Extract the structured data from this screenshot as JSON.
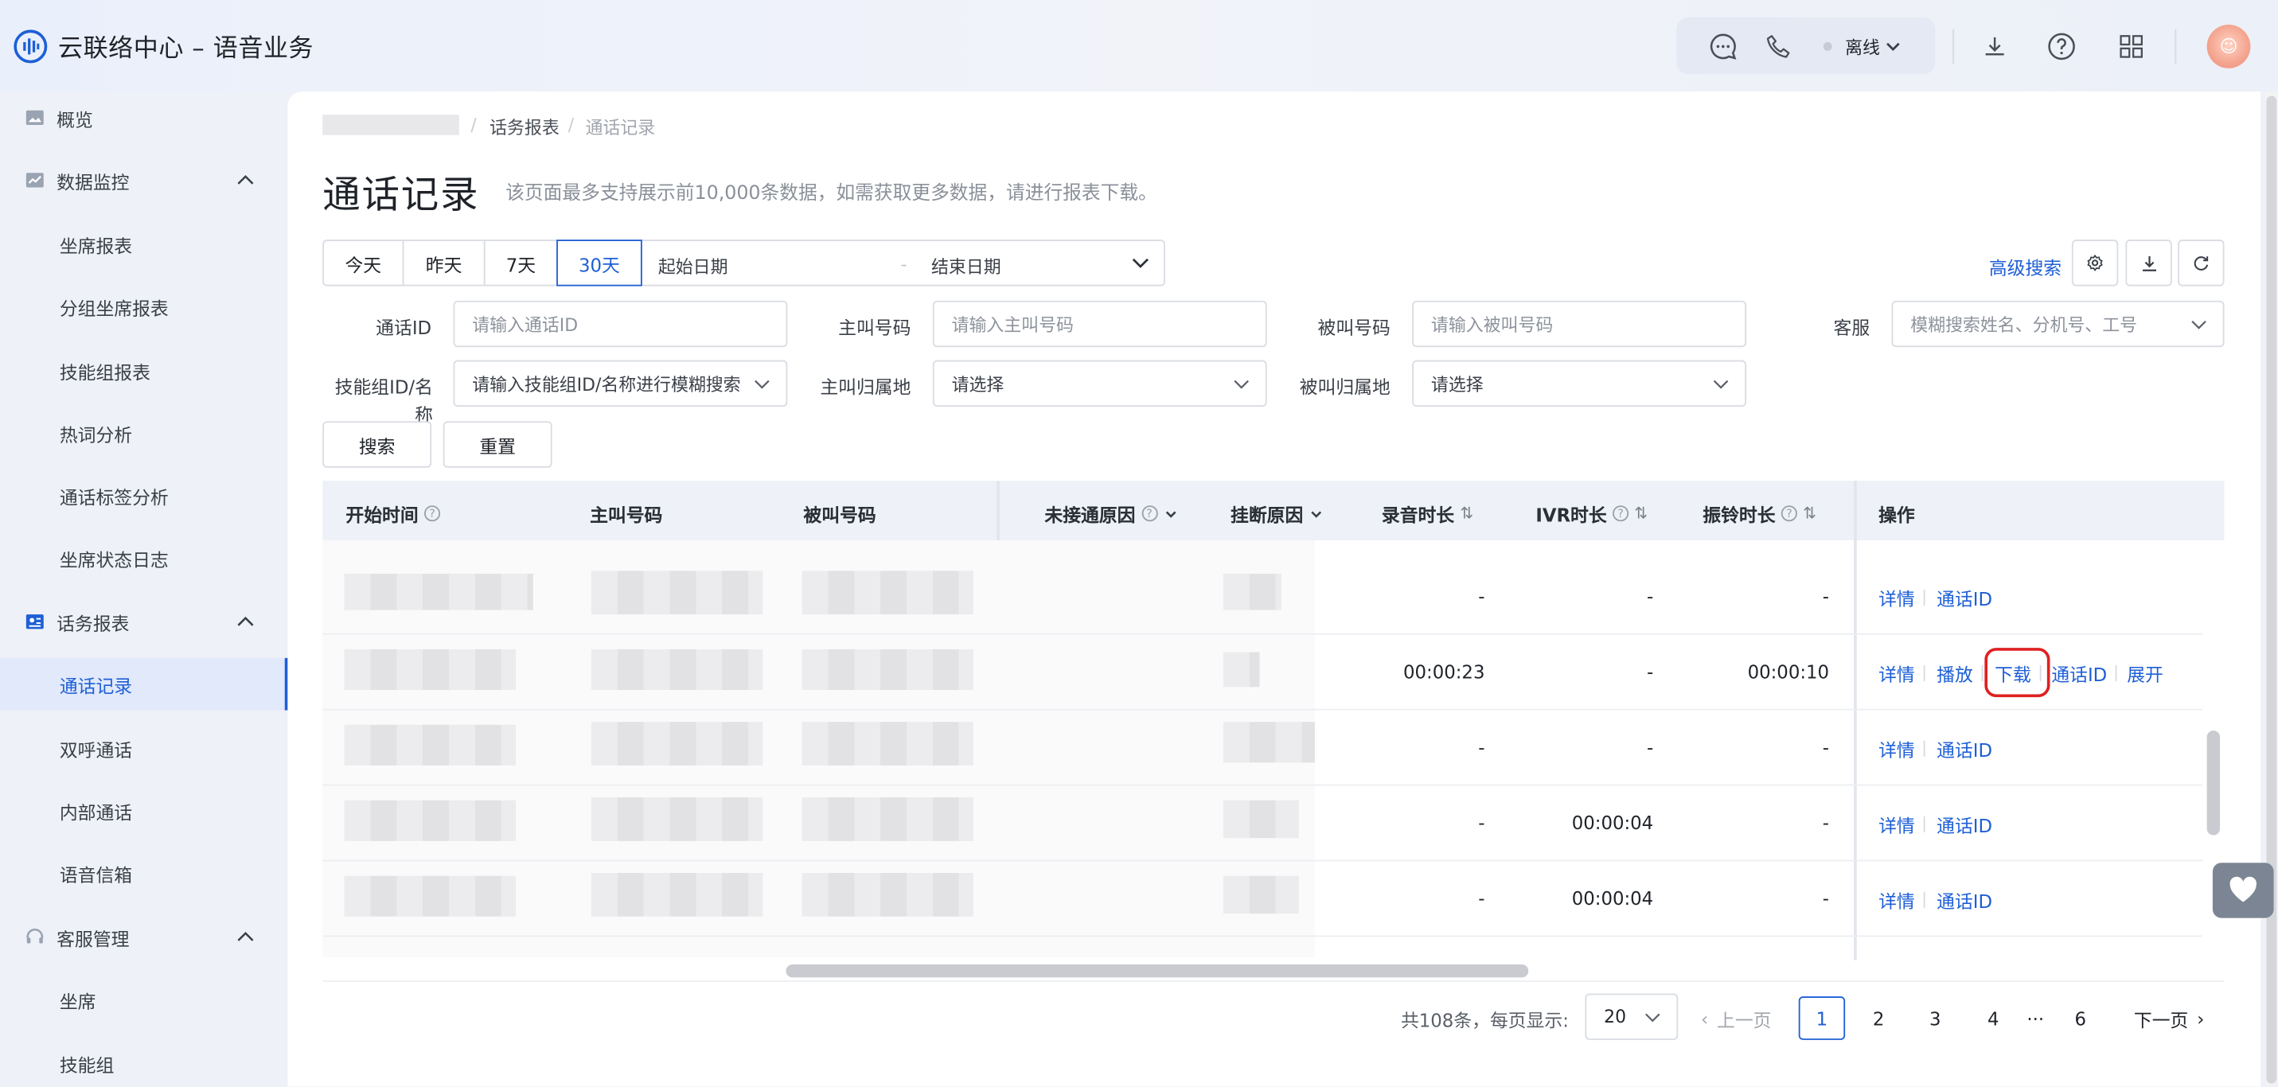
{
  "app": {
    "title": "云联络中心 – 语音业务"
  },
  "topbar": {
    "status": "离线"
  },
  "sidebar": {
    "items": [
      {
        "label": "概览",
        "icon": "image-icon"
      },
      {
        "label": "数据监控",
        "icon": "chart-icon"
      },
      {
        "label": "坐席报表"
      },
      {
        "label": "分组坐席报表"
      },
      {
        "label": "技能组报表"
      },
      {
        "label": "热词分析"
      },
      {
        "label": "通话标签分析"
      },
      {
        "label": "坐席状态日志"
      },
      {
        "label": "话务报表",
        "icon": "report-icon"
      },
      {
        "label": "通话记录"
      },
      {
        "label": "双呼通话"
      },
      {
        "label": "内部通话"
      },
      {
        "label": "语音信箱"
      },
      {
        "label": "客服管理",
        "icon": "headset-icon"
      },
      {
        "label": "坐席"
      },
      {
        "label": "技能组"
      }
    ]
  },
  "breadcrumb": {
    "level2": "话务报表",
    "level3": "通话记录"
  },
  "page": {
    "title": "通话记录",
    "hint": "该页面最多支持展示前10,000条数据，如需获取更多数据，请进行报表下载。"
  },
  "filters": {
    "ranges": [
      "今天",
      "昨天",
      "7天",
      "30天"
    ],
    "start_date": "起始日期",
    "end_date": "结束日期",
    "range_sep": "-",
    "advanced": "高级搜索",
    "call_id_label": "通话ID",
    "call_id_ph": "请输入通话ID",
    "caller_label": "主叫号码",
    "caller_ph": "请输入主叫号码",
    "callee_label": "被叫号码",
    "callee_ph": "请输入被叫号码",
    "agent_label": "客服",
    "agent_ph": "模糊搜索姓名、分机号、工号",
    "skill_label": "技能组ID/名称",
    "skill_ph": "请输入技能组ID/名称进行模糊搜索",
    "caller_loc_label": "主叫归属地",
    "caller_loc_ph": "请选择",
    "callee_loc_label": "被叫归属地",
    "callee_loc_ph": "请选择",
    "search": "搜索",
    "reset": "重置"
  },
  "table": {
    "headers": [
      "开始时间",
      "主叫号码",
      "被叫号码",
      "未接通原因",
      "挂断原因",
      "录音时长",
      "IVR时长",
      "振铃时长",
      "操作"
    ],
    "rows": [
      {
        "rec": "-",
        "ivr": "-",
        "ring": "-",
        "ops": [
          "详情",
          "通话ID"
        ]
      },
      {
        "rec": "00:00:23",
        "ivr": "-",
        "ring": "00:00:10",
        "ops": [
          "详情",
          "播放",
          "下载",
          "通话ID",
          "展开"
        ]
      },
      {
        "rec": "-",
        "ivr": "-",
        "ring": "-",
        "ops": [
          "详情",
          "通话ID"
        ]
      },
      {
        "rec": "-",
        "ivr": "00:00:04",
        "ring": "-",
        "ops": [
          "详情",
          "通话ID"
        ]
      },
      {
        "rec": "-",
        "ivr": "00:00:04",
        "ring": "-",
        "ops": [
          "详情",
          "通话ID"
        ]
      }
    ]
  },
  "pagination": {
    "total": "共108条，每页显示:",
    "page_size": "20",
    "prev": "上一页",
    "pages": [
      "1",
      "2",
      "3",
      "4",
      "···",
      "6"
    ],
    "next": "下一页",
    "current": "1"
  }
}
